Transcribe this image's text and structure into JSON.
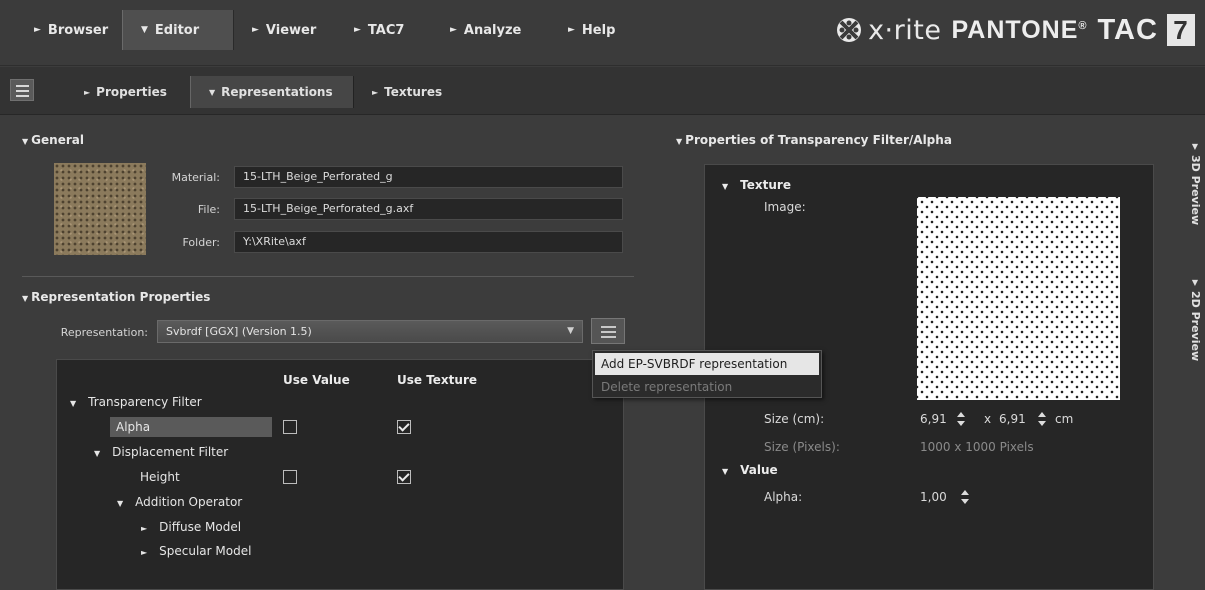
{
  "top_nav": {
    "tabs": [
      {
        "label": "Browser",
        "arrow": "►"
      },
      {
        "label": "Editor",
        "arrow": "▼"
      },
      {
        "label": "Viewer",
        "arrow": "►"
      },
      {
        "label": "TAC7",
        "arrow": "►"
      },
      {
        "label": "Analyze",
        "arrow": "►"
      },
      {
        "label": "Help",
        "arrow": "►"
      }
    ],
    "brand": {
      "xrite": "x·rite",
      "pantone": "PANTONE",
      "reg": "®",
      "tac": "TAC",
      "version": "7"
    }
  },
  "sub_nav": {
    "tabs": [
      {
        "label": "Properties",
        "arrow": "►"
      },
      {
        "label": "Representations",
        "arrow": "▼"
      },
      {
        "label": "Textures",
        "arrow": "►"
      }
    ]
  },
  "general": {
    "heading": "General",
    "material_label": "Material:",
    "material_value": "15-LTH_Beige_Perforated_g",
    "file_label": "File:",
    "file_value": "15-LTH_Beige_Perforated_g.axf",
    "folder_label": "Folder:",
    "folder_value": "Y:\\XRite\\axf"
  },
  "representation": {
    "heading": "Representation Properties",
    "label": "Representation:",
    "selected": "Svbrdf [GGX] (Version 1.5)",
    "col_use_value": "Use Value",
    "col_use_texture": "Use Texture",
    "tree": {
      "transparency_filter": "Transparency Filter",
      "alpha": "Alpha",
      "displacement_filter": "Displacement Filter",
      "height": "Height",
      "addition_operator": "Addition Operator",
      "diffuse_model": "Diffuse Model",
      "specular_model": "Specular Model"
    },
    "checkboxes": {
      "alpha_use_value": false,
      "alpha_use_texture": true,
      "height_use_value": false,
      "height_use_texture": true
    }
  },
  "popup_menu": {
    "add": "Add EP-SVBRDF representation",
    "delete": "Delete representation"
  },
  "right_panel": {
    "heading": "Properties of Transparency Filter/Alpha",
    "texture_heading": "Texture",
    "image_label": "Image:",
    "size_cm_label": "Size (cm):",
    "size_w": "6,91",
    "size_x": "x",
    "size_h": "6,91",
    "size_unit": "cm",
    "size_px_label": "Size (Pixels):",
    "size_px_value": "1000 x 1000 Pixels",
    "value_heading": "Value",
    "alpha_label": "Alpha:",
    "alpha_value": "1,00"
  },
  "side_tabs": {
    "preview_3d": "3D Preview",
    "preview_2d": "2D Preview"
  }
}
